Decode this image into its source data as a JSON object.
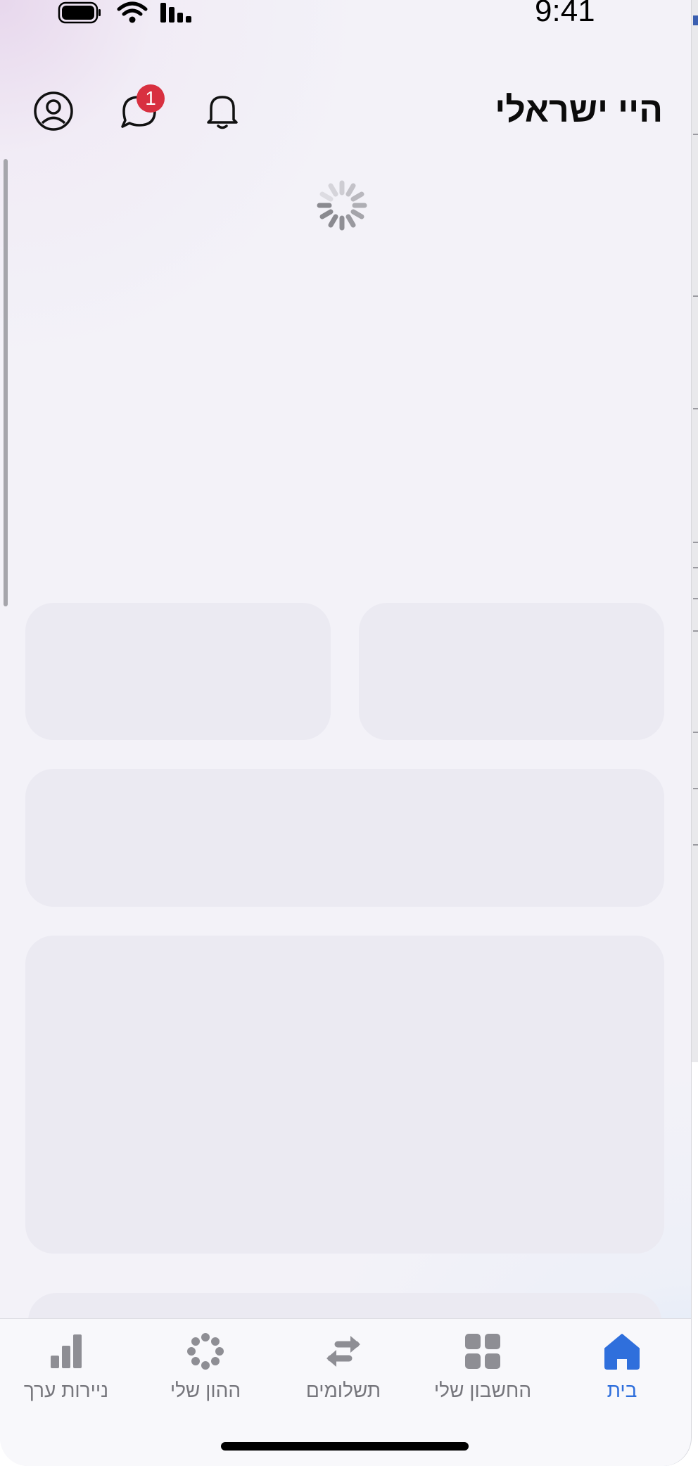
{
  "status_bar": {
    "time": "9:41",
    "battery_icon": "battery-full-icon",
    "wifi_icon": "wifi-icon",
    "signal_icon": "cellular-signal-icon"
  },
  "header": {
    "greeting": "היי ישראלי",
    "profile_icon": "profile-circle-icon",
    "chat_icon": "chat-bubbles-icon",
    "chat_badge_count": "1",
    "notifications_icon": "bell-icon"
  },
  "loading": {
    "spinner_icon": "activity-spinner-icon"
  },
  "tab_bar": {
    "items": [
      {
        "label": "ניירות ערך",
        "icon": "bar-chart-icon",
        "active": false
      },
      {
        "label": "ההון שלי",
        "icon": "dots-ring-icon",
        "active": false
      },
      {
        "label": "תשלומים",
        "icon": "transfer-arrows-icon",
        "active": false
      },
      {
        "label": "החשבון שלי",
        "icon": "grid-squares-icon",
        "active": false
      },
      {
        "label": "בית",
        "icon": "home-icon",
        "active": true
      }
    ]
  },
  "colors": {
    "accent": "#2f6fdc",
    "inactive": "#76767c",
    "badge": "#d83040",
    "skeleton": "#ebeaf2"
  }
}
